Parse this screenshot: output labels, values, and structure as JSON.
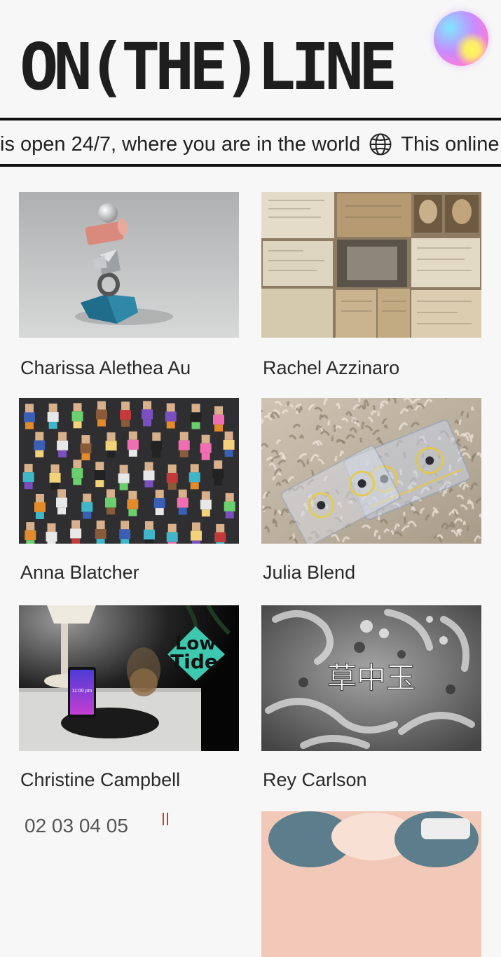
{
  "header": {
    "logo_text": "ON(THE)LINE",
    "orb_icon": "gradient-orb-icon"
  },
  "ticker": {
    "text_before": "is open 24/7, where you are in the world",
    "icon": "globe-icon",
    "text_after": "This online"
  },
  "artists": [
    {
      "name": "Charissa Alethea Au"
    },
    {
      "name": "Rachel Azzinaro"
    },
    {
      "name": "Anna Blatcher"
    },
    {
      "name": "Julia Blend"
    },
    {
      "name": "Christine Campbell"
    },
    {
      "name": "Rey Carlson"
    }
  ],
  "thumbnail_text": {
    "lowtide_line1": "Low",
    "lowtide_line2": "Tide",
    "phone_time": "11:00 pm",
    "rey_chars": "草中玉",
    "calendar_numbers": "02   03   04   05"
  },
  "colors": {
    "background": "#f7f7f7",
    "text": "#2a2a2a",
    "rule": "#111111",
    "lowtide_teal": "#3ec8b0"
  }
}
